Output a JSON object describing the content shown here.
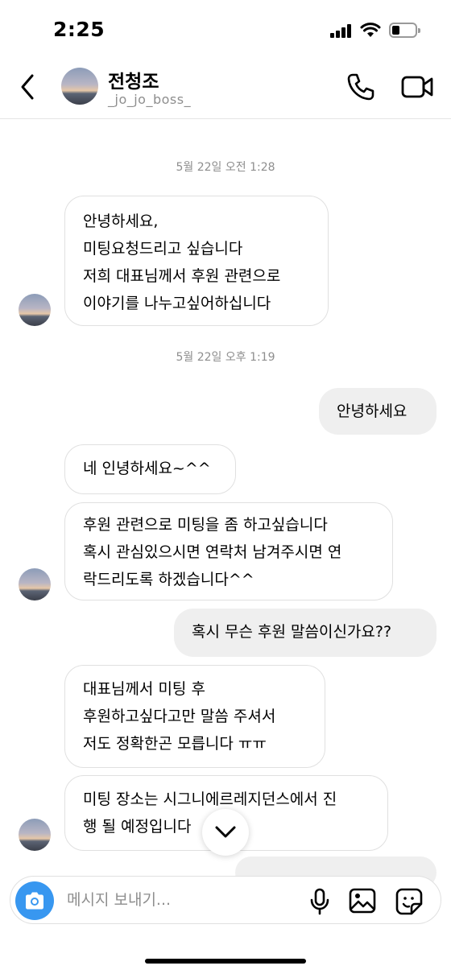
{
  "status_bar": {
    "time": "2:25",
    "battery_level": 0.3
  },
  "header": {
    "name": "전청조",
    "username": "_jo_jo_boss_"
  },
  "thread": {
    "stamp1": "5월 22일 오전 1:28",
    "stamp2": "5월 22일 오후 1:19",
    "msg1": [
      "안녕하세요,",
      "미팅요청드리고 싶습니다",
      "저희 대표님께서 후원 관련으로",
      "이야기를 나누고싶어하십니다"
    ],
    "msg2": "안녕하세요",
    "msg3": "네 인녕하세요~^^",
    "msg4": [
      "후원 관련으로 미팅을 좀 하고싶습니다",
      "혹시 관심있으시면 연락처 남겨주시면 연",
      "락드리도록 하겠습니다^^"
    ],
    "msg5": "혹시 무슨 후원 말씀이신가요??",
    "msg6": [
      "대표님께서 미팅 후",
      "후원하고싶다고만 말씀 주셔서",
      "저도 정확한곤 모릅니다 ㅠㅠ"
    ],
    "msg7": [
      "미팅 장소는 시그니에르레지던스에서 진",
      "행 될 예정입니다"
    ]
  },
  "composer": {
    "placeholder": "메시지 보내기..."
  },
  "icons": {
    "back": "chevron-left-icon",
    "call": "phone-icon",
    "video": "video-camera-icon",
    "camera": "camera-icon",
    "mic": "microphone-icon",
    "gallery": "gallery-icon",
    "sticker": "sticker-icon",
    "scroll": "chevron-down-icon"
  },
  "colors": {
    "accent": "#3897f0",
    "outgoing_bubble": "#efefef",
    "timestamp": "#8e8e8e"
  }
}
